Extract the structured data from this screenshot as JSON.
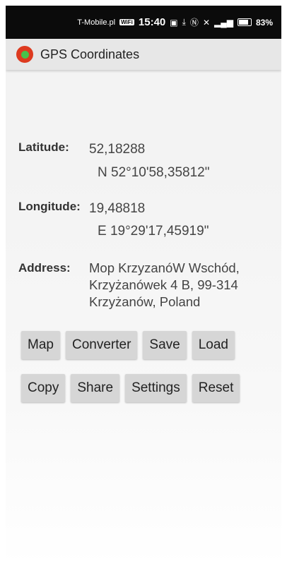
{
  "status_bar": {
    "carrier": "T-Mobile.pl",
    "carrier_badge": "WiFi",
    "time": "15:40",
    "icons": [
      "message-icon",
      "download-icon",
      "nfc-icon",
      "mute-icon",
      "signal-icon"
    ],
    "battery": "83%"
  },
  "app_bar": {
    "title": "GPS Coordinates",
    "icon": "location-pin-icon",
    "icon_colors": {
      "outer": "#dd3a1f",
      "inner": "#47c14b"
    }
  },
  "latitude": {
    "label": "Latitude:",
    "decimal": "52,18288",
    "dms": "N 52°10'58,35812\""
  },
  "longitude": {
    "label": "Longitude:",
    "decimal": "19,48818",
    "dms": "E 19°29'17,45919\""
  },
  "address": {
    "label": "Address:",
    "lines": [
      "Mop KrzyzanóW Wschód,",
      "Krzyżanówek 4 B, 99-314",
      "Krzyżanów, Poland"
    ]
  },
  "buttons": {
    "map": "Map",
    "converter": "Converter",
    "save": "Save",
    "load": "Load",
    "copy": "Copy",
    "share": "Share",
    "settings": "Settings",
    "reset": "Reset"
  }
}
